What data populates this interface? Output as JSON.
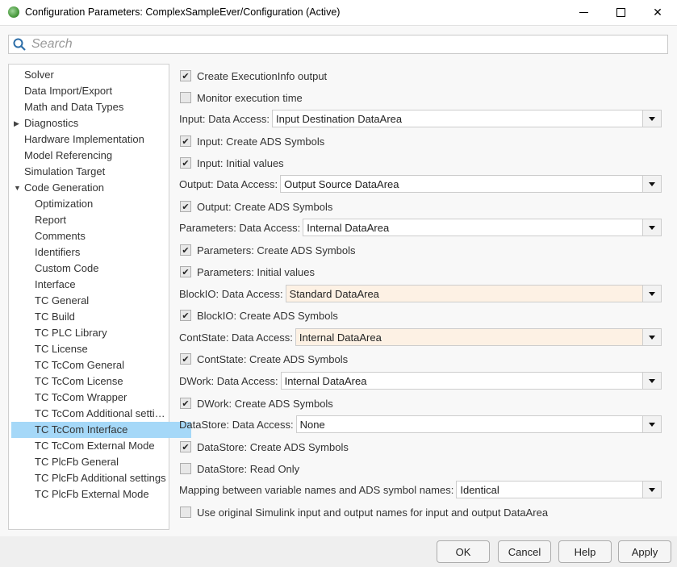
{
  "window": {
    "title": "Configuration Parameters: ComplexSampleEver/Configuration (Active)",
    "app_icon": "simulink-config-icon",
    "controls": {
      "minimize": "minimize-icon",
      "maximize": "maximize-icon",
      "close": "close-icon"
    }
  },
  "search": {
    "placeholder": "Search",
    "value": ""
  },
  "tree": {
    "items": [
      {
        "label": "Solver",
        "level": 0
      },
      {
        "label": "Data Import/Export",
        "level": 0
      },
      {
        "label": "Math and Data Types",
        "level": 0
      },
      {
        "label": "Diagnostics",
        "level": 0,
        "expander": "collapsed"
      },
      {
        "label": "Hardware Implementation",
        "level": 0
      },
      {
        "label": "Model Referencing",
        "level": 0
      },
      {
        "label": "Simulation Target",
        "level": 0
      },
      {
        "label": "Code Generation",
        "level": 0,
        "expander": "expanded"
      },
      {
        "label": "Optimization",
        "level": 1
      },
      {
        "label": "Report",
        "level": 1
      },
      {
        "label": "Comments",
        "level": 1
      },
      {
        "label": "Identifiers",
        "level": 1
      },
      {
        "label": "Custom Code",
        "level": 1
      },
      {
        "label": "Interface",
        "level": 1
      },
      {
        "label": "TC General",
        "level": 1
      },
      {
        "label": "TC Build",
        "level": 1
      },
      {
        "label": "TC PLC Library",
        "level": 1
      },
      {
        "label": "TC License",
        "level": 1
      },
      {
        "label": "TC TcCom General",
        "level": 1
      },
      {
        "label": "TC TcCom License",
        "level": 1
      },
      {
        "label": "TC TcCom Wrapper",
        "level": 1
      },
      {
        "label": "TC TcCom Additional setti…",
        "level": 1
      },
      {
        "label": "TC TcCom Interface",
        "level": 1,
        "selected": true
      },
      {
        "label": "TC TcCom External Mode",
        "level": 1
      },
      {
        "label": "TC PlcFb General",
        "level": 1
      },
      {
        "label": "TC PlcFb Additional settings",
        "level": 1
      },
      {
        "label": "TC PlcFb External Mode",
        "level": 1
      }
    ]
  },
  "panel": {
    "rows": [
      {
        "type": "checkbox",
        "label": "Create ExecutionInfo output",
        "checked": true
      },
      {
        "type": "checkbox",
        "label": "Monitor execution time",
        "checked": false
      },
      {
        "type": "combo",
        "label": "Input: Data Access:",
        "value": "Input Destination DataArea",
        "modified": false
      },
      {
        "type": "checkbox",
        "label": "Input: Create ADS Symbols",
        "checked": true
      },
      {
        "type": "checkbox",
        "label": "Input: Initial values",
        "checked": true
      },
      {
        "type": "combo",
        "label": "Output: Data Access:",
        "value": "Output Source DataArea",
        "modified": false
      },
      {
        "type": "checkbox",
        "label": "Output: Create ADS Symbols",
        "checked": true
      },
      {
        "type": "combo",
        "label": "Parameters: Data Access:",
        "value": "Internal DataArea",
        "modified": false
      },
      {
        "type": "checkbox",
        "label": "Parameters: Create ADS Symbols",
        "checked": true
      },
      {
        "type": "checkbox",
        "label": "Parameters: Initial values",
        "checked": true
      },
      {
        "type": "combo",
        "label": "BlockIO: Data Access:",
        "value": "Standard DataArea",
        "modified": true
      },
      {
        "type": "checkbox",
        "label": "BlockIO: Create ADS Symbols",
        "checked": true
      },
      {
        "type": "combo",
        "label": "ContState: Data Access:",
        "value": "Internal DataArea",
        "modified": true
      },
      {
        "type": "checkbox",
        "label": "ContState: Create ADS Symbols",
        "checked": true
      },
      {
        "type": "combo",
        "label": "DWork: Data Access:",
        "value": "Internal DataArea",
        "modified": false
      },
      {
        "type": "checkbox",
        "label": "DWork: Create ADS Symbols",
        "checked": true
      },
      {
        "type": "combo",
        "label": "DataStore: Data Access:",
        "value": "None",
        "modified": false
      },
      {
        "type": "checkbox",
        "label": "DataStore: Create ADS Symbols",
        "checked": true
      },
      {
        "type": "checkbox",
        "label": "DataStore: Read Only",
        "checked": false
      },
      {
        "type": "combo",
        "label": "Mapping between variable names and ADS symbol names:",
        "value": "Identical",
        "modified": false
      },
      {
        "type": "checkbox",
        "label": "Use original Simulink input and output names for input and output DataArea",
        "checked": false
      }
    ]
  },
  "buttons": {
    "ok": "OK",
    "cancel": "Cancel",
    "help": "Help",
    "apply": "Apply"
  },
  "colors": {
    "selection": "#a5d8f8",
    "modified_field": "#fdf1e4"
  }
}
